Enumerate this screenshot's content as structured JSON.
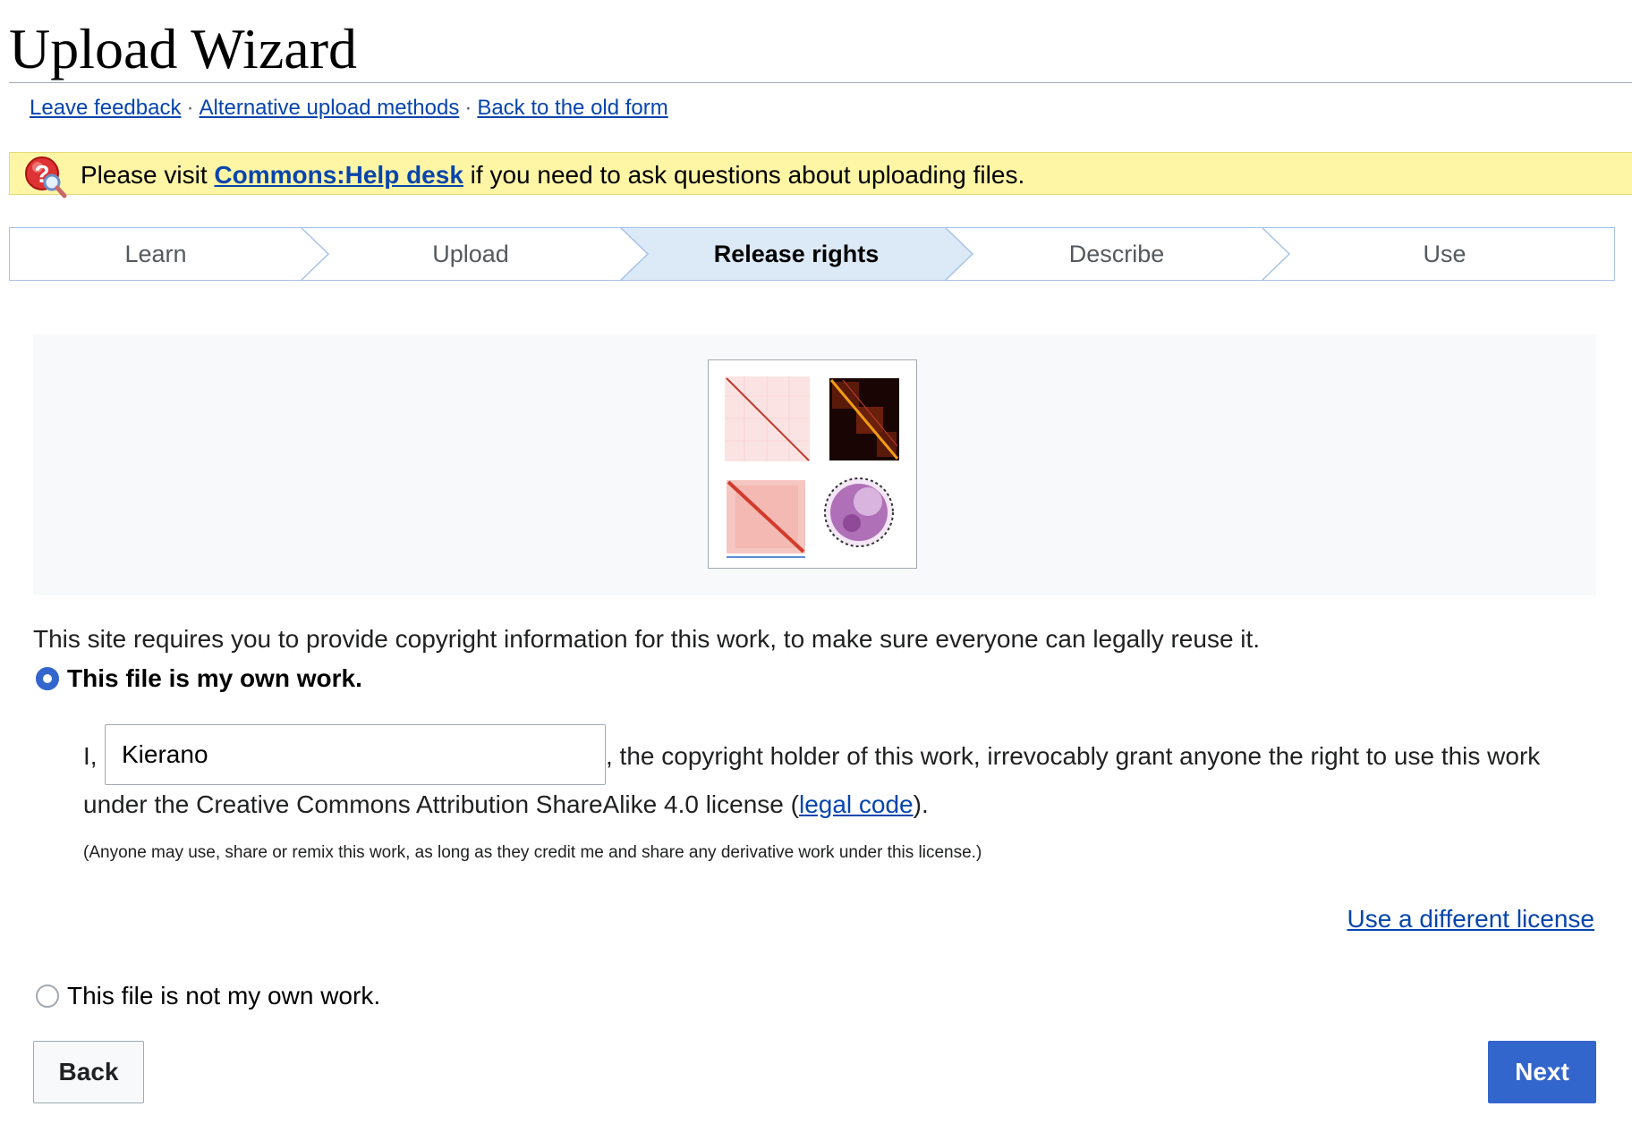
{
  "header": {
    "title": "Upload Wizard"
  },
  "toplinks": [
    {
      "label": "Leave feedback"
    },
    {
      "label": "Alternative upload methods"
    },
    {
      "label": "Back to the old form"
    }
  ],
  "toplinks_separator": "·",
  "notice": {
    "prefix": "Please visit ",
    "link": "Commons:Help desk",
    "suffix": " if you need to ask questions about uploading files.",
    "icon": "help-question-icon"
  },
  "steps": [
    {
      "label": "Learn",
      "active": false
    },
    {
      "label": "Upload",
      "active": false
    },
    {
      "label": "Release rights",
      "active": true
    },
    {
      "label": "Describe",
      "active": false
    },
    {
      "label": "Use",
      "active": false
    }
  ],
  "intro": "This site requires you to provide copyright information for this work, to make sure everyone can legally reuse it.",
  "own_work": {
    "label": "This file is my own work.",
    "selected": true,
    "grant_prefix": "I,",
    "author_value": "Kierano",
    "grant_suffix": ", the copyright holder of this work, irrevocably grant anyone the right to use this work",
    "line2_prefix": "under the Creative Commons Attribution ShareAlike 4.0 license (",
    "line2_link": "legal code",
    "line2_suffix": ").",
    "note": "(Anyone may use, share or remix this work, as long as they credit me and share any derivative work under this license.)"
  },
  "different_license_link": "Use a different license",
  "not_own_work": {
    "label": "This file is not my own work.",
    "selected": false
  },
  "buttons": {
    "back": "Back",
    "next": "Next"
  },
  "colors": {
    "link": "#0645ad",
    "accent": "#3366cc",
    "notice_bg": "#fef6a5",
    "active_step_bg": "#dce9f7"
  }
}
